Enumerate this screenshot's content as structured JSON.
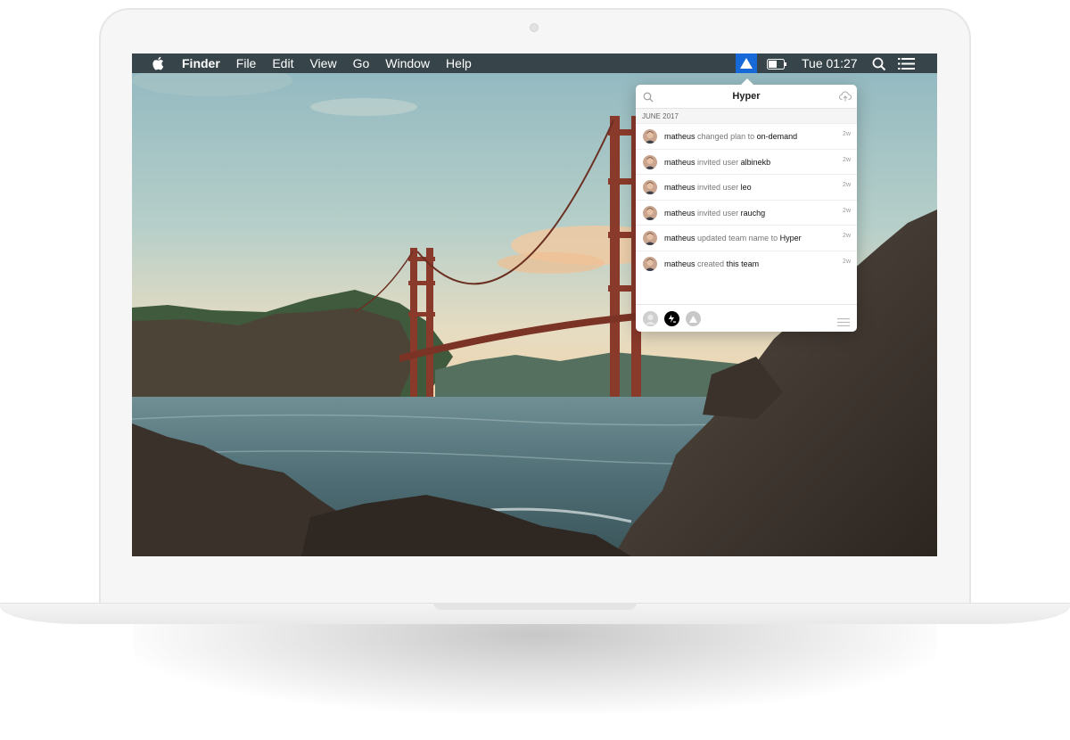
{
  "menubar": {
    "apple_icon": "apple-logo-icon",
    "app_name": "Finder",
    "menus": [
      "File",
      "Edit",
      "View",
      "Go",
      "Window",
      "Help"
    ],
    "clock": "Tue 01:27",
    "status_icons": [
      "hyper-triangle-icon",
      "battery-icon",
      "spotlight-search-icon",
      "notification-list-icon"
    ]
  },
  "popover": {
    "title": "Hyper",
    "section": "JUNE 2017",
    "events": [
      {
        "user": "matheus",
        "action": "changed plan to",
        "target": "on-demand",
        "age": "2w"
      },
      {
        "user": "matheus",
        "action": "invited user",
        "target": "albinekb",
        "age": "2w"
      },
      {
        "user": "matheus",
        "action": "invited user",
        "target": "leo",
        "age": "2w"
      },
      {
        "user": "matheus",
        "action": "invited user",
        "target": "rauchg",
        "age": "2w"
      },
      {
        "user": "matheus",
        "action": "updated team name to",
        "target": "Hyper",
        "age": "2w"
      },
      {
        "user": "matheus",
        "action": "created",
        "target": "this team",
        "age": "2w"
      }
    ],
    "footer_icons": [
      "user-avatar-icon",
      "hyper-team-icon",
      "triangle-account-icon",
      "hamburger-menu-icon"
    ]
  },
  "colors": {
    "menubar_bg": "#37444a",
    "accent": "#1769d8",
    "laptop_frame": "#f6f6f6"
  }
}
